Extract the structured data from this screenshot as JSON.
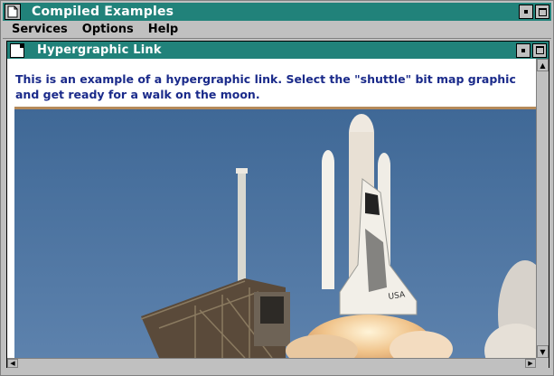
{
  "window": {
    "title": "Compiled Examples",
    "system_icon": "document-icon",
    "controls": [
      "minimize-icon",
      "maximize-icon"
    ]
  },
  "menu": {
    "items": [
      "Services",
      "Options",
      "Help"
    ]
  },
  "child_window": {
    "title": "Hypergraphic Link",
    "icon": "document-icon",
    "body_text": "This is an example of a hypergraphic link.  Select the \"shuttle\" bit map graphic and get ready for a walk on the moon.",
    "graphic": "space-shuttle-launch-image"
  },
  "colors": {
    "titlebar": "#21827a",
    "text": "#1a2a8a",
    "sky": "#4a6f9c"
  }
}
